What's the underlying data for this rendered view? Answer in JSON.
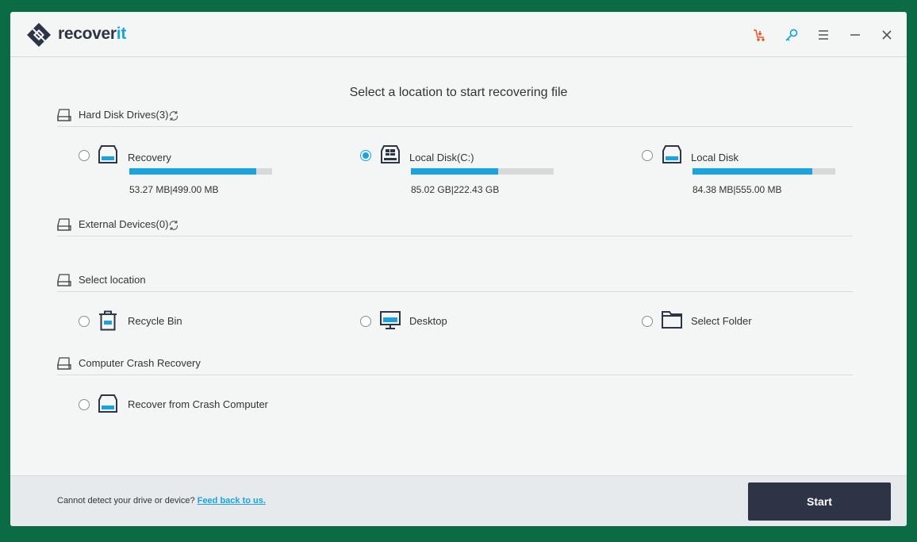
{
  "app": {
    "logo_text_main": "recover",
    "logo_text_accent": "it"
  },
  "titlebar": {
    "icons": [
      "cart-icon",
      "key-icon",
      "menu-icon",
      "minimize-icon",
      "close-icon"
    ]
  },
  "heading": "Select a location to start recovering file",
  "sections": {
    "hard_disks": {
      "label": "Hard Disk Drives(3)"
    },
    "external": {
      "label": "External Devices(0)"
    },
    "location": {
      "label": "Select location"
    },
    "crash": {
      "label": "Computer Crash Recovery"
    }
  },
  "drives": [
    {
      "name": "Recovery",
      "size": "53.27  MB|499.00  MB",
      "used_fraction": 0.89,
      "selected": false,
      "icon": "drive-icon"
    },
    {
      "name": "Local Disk(C:)",
      "size": "85.02  GB|222.43  GB",
      "used_fraction": 0.61,
      "selected": true,
      "icon": "windows-drive-icon"
    },
    {
      "name": "Local Disk",
      "size": "84.38  MB|555.00  MB",
      "used_fraction": 0.84,
      "selected": false,
      "icon": "drive-icon"
    }
  ],
  "locations": [
    {
      "name": "Recycle Bin",
      "icon": "recycle-bin-icon"
    },
    {
      "name": "Desktop",
      "icon": "desktop-icon"
    },
    {
      "name": "Select Folder",
      "icon": "folder-icon"
    }
  ],
  "crash_item": {
    "name": "Recover from Crash Computer",
    "icon": "crash-drive-icon"
  },
  "footer": {
    "note": "Cannot detect your drive or device?",
    "link": "Feed back to us.",
    "start_label": "Start"
  },
  "colors": {
    "accent": "#1aa3dc",
    "dark": "#2c3446",
    "cart": "#e8582a",
    "frame": "#0b6b45"
  }
}
